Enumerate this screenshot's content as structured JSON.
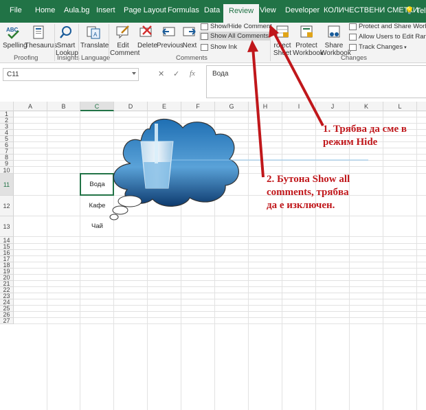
{
  "tabs": [
    {
      "label": "File"
    },
    {
      "label": "Home"
    },
    {
      "label": "Aula.bg"
    },
    {
      "label": "Insert"
    },
    {
      "label": "Page Layout"
    },
    {
      "label": "Formulas"
    },
    {
      "label": "Data"
    },
    {
      "label": "Review",
      "active": true
    },
    {
      "label": "View"
    },
    {
      "label": "Developer"
    },
    {
      "label": "КОЛИЧЕСТВЕНИ СМЕТКИ"
    },
    {
      "label": "Tell m"
    }
  ],
  "ribbon": {
    "spelling": "Spelling",
    "thesaurus": "Thesaurus",
    "smart_lookup_1": "Smart",
    "smart_lookup_2": "Lookup",
    "translate": "Translate",
    "edit_comment_1": "Edit",
    "edit_comment_2": "Comment",
    "delete": "Delete",
    "previous": "Previous",
    "next": "Next",
    "show_hide_comment": "Show/Hide Comment",
    "show_all_comments": "Show All Comments",
    "show_ink": "Show Ink",
    "protect_sheet_1": "rotect",
    "protect_sheet_2": "Sheet",
    "protect_workbook_1": "Protect",
    "protect_workbook_2": "Workbook",
    "share_workbook_1": "Share",
    "share_workbook_2": "Workbook",
    "protect_share": "Protect and Share Workbook",
    "allow_users": "Allow Users to Edit Ranges",
    "track_changes": "Track Changes",
    "groups": {
      "proofing": "Proofing",
      "insights": "Insights",
      "language": "Language",
      "comments": "Comments",
      "changes": "Changes"
    }
  },
  "formula_bar": {
    "name_box": "C11",
    "fx": "fx",
    "content": "Вода"
  },
  "columns": [
    "A",
    "B",
    "C",
    "D",
    "E",
    "F",
    "G",
    "H",
    "I",
    "J",
    "K",
    "L"
  ],
  "rows": [
    "1",
    "2",
    "3",
    "4",
    "5",
    "6",
    "7",
    "8",
    "9",
    "10",
    "11",
    "12",
    "13",
    "14",
    "15",
    "16",
    "17",
    "18",
    "19",
    "20",
    "21",
    "22",
    "23",
    "24",
    "25",
    "26",
    "27"
  ],
  "selected_column": "C",
  "selected_row": "11",
  "cells": {
    "c11": "Вода",
    "c12": "Кафе",
    "c13": "Чай"
  },
  "annotations": {
    "note1": "1. Трябва да сме в\nрежим Hide",
    "note2": "2. Бутона Show all\ncomments, трябва\nда е изключен."
  },
  "colors": {
    "excel_green": "#217346",
    "annotation_red": "#c0171b"
  }
}
